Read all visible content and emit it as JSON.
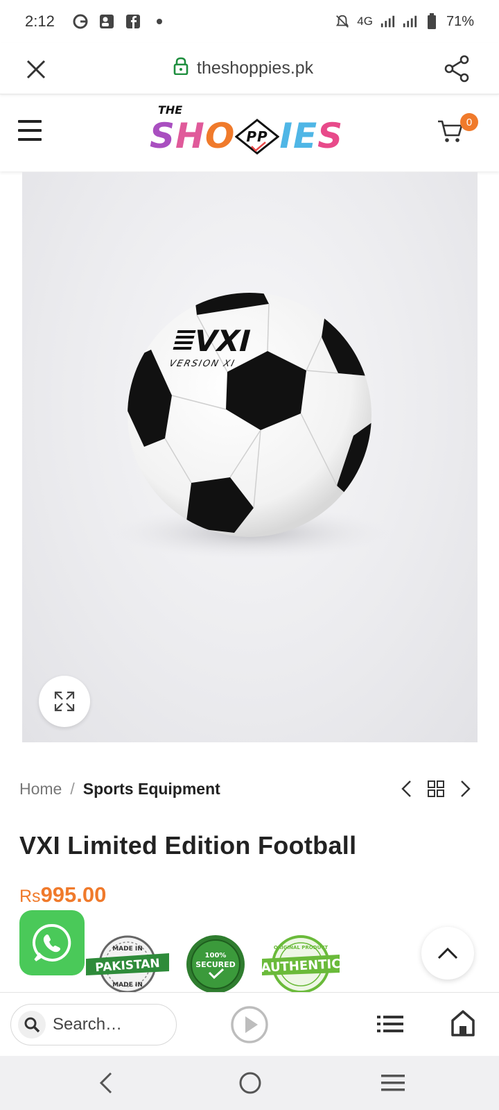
{
  "status_bar": {
    "time": "2:12",
    "network": "4G",
    "battery": "71%",
    "icons": [
      "google-icon",
      "contacts-icon",
      "facebook-icon",
      "dot-icon",
      "mute-icon",
      "signal-icon",
      "battery-icon"
    ]
  },
  "browser": {
    "url": "theshoppies.pk",
    "close_icon": "close-icon",
    "share_icon": "share-icon",
    "lock_color": "#1e8e3e"
  },
  "header": {
    "logo": {
      "top": "THE",
      "letters": [
        "S",
        "H",
        "O",
        "PP",
        "I",
        "E",
        "S"
      ]
    },
    "cart_count": "0",
    "accent": "#f07a2b"
  },
  "product": {
    "ball_brand": "VXI",
    "ball_subtext": "VERSION XI",
    "breadcrumb": {
      "home": "Home",
      "separator": "/",
      "current": "Sports Equipment"
    },
    "title": "VXI Limited Edition Football",
    "price_currency": "Rs",
    "price_amount": "995.00"
  },
  "badges": [
    {
      "name": "made-in-pakistan",
      "text": "PAKISTAN",
      "top": "MADE IN",
      "bottom": "MADE IN"
    },
    {
      "name": "secured",
      "top": "100%",
      "text": "SECURED"
    },
    {
      "name": "authentic",
      "top": "ORIGINAL PRODUCT",
      "text": "AUTHENTIC"
    }
  ],
  "bottom_toolbar": {
    "search_placeholder": "Search…"
  }
}
